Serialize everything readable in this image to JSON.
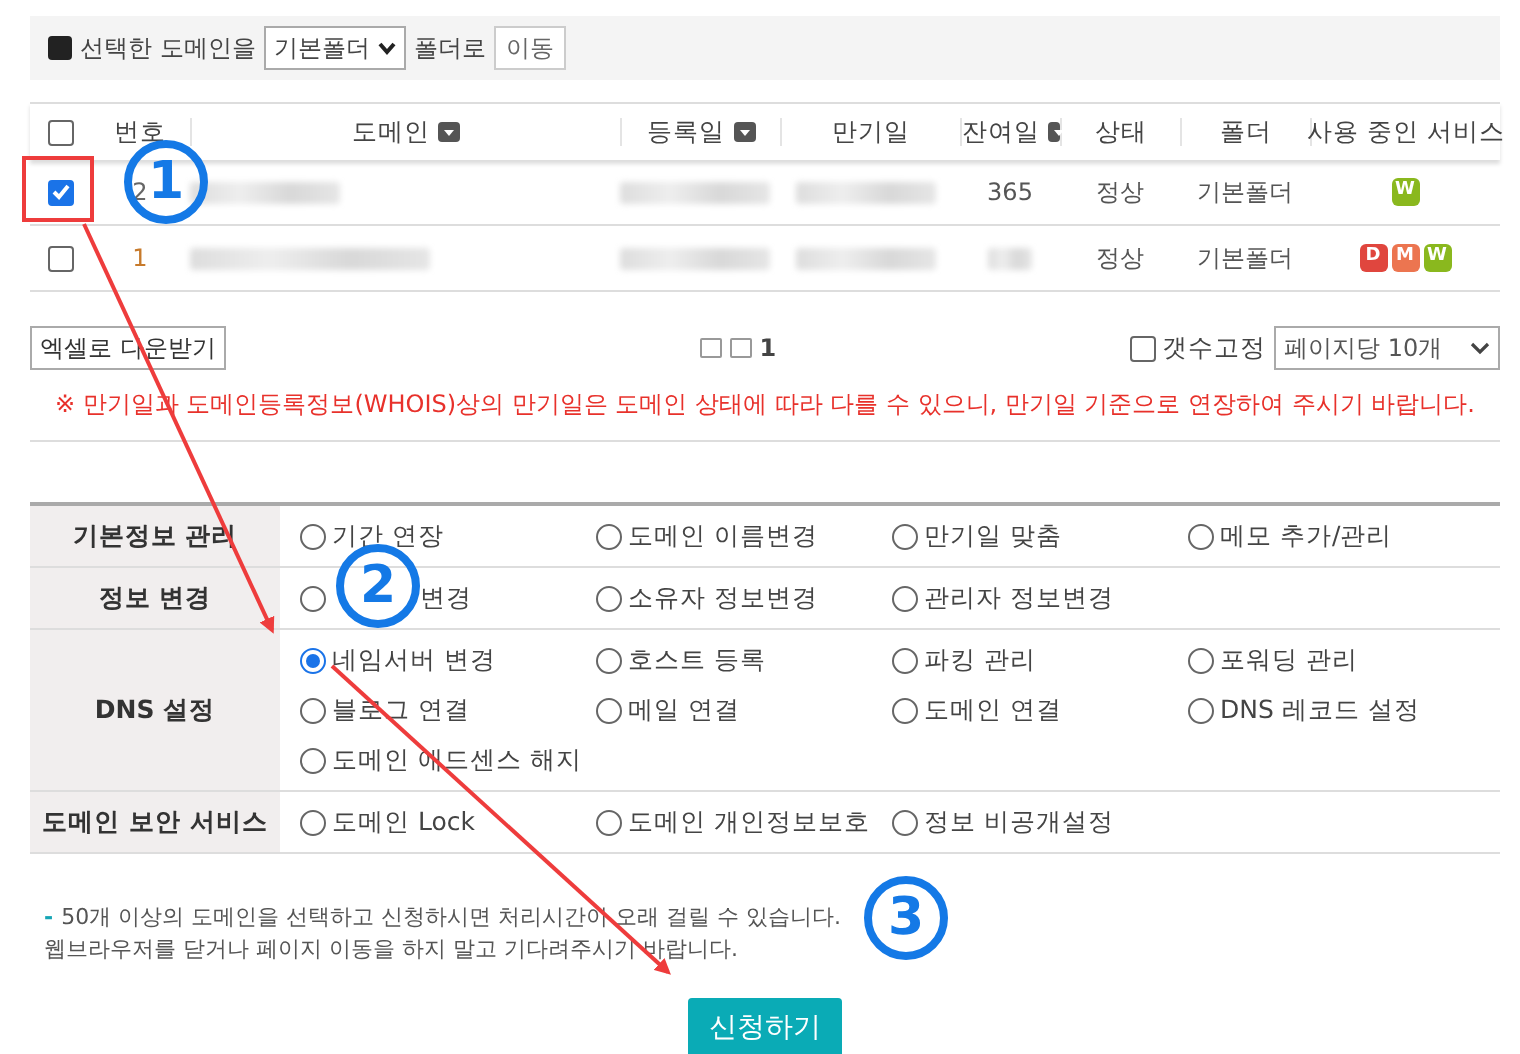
{
  "toolbar": {
    "label_before": "선택한 도메인을",
    "folder_select": "기본폴더",
    "label_after": "폴더로",
    "move_button": "이동"
  },
  "table": {
    "select_all": {
      "checked": false
    },
    "columns": [
      {
        "label": "번호",
        "sortable": false
      },
      {
        "label": "도메인",
        "sortable": true
      },
      {
        "label": "등록일",
        "sortable": true
      },
      {
        "label": "만기일",
        "sortable": false
      },
      {
        "label": "잔여일",
        "sortable": true
      },
      {
        "label": "상태",
        "sortable": false
      },
      {
        "label": "폴더",
        "sortable": false
      },
      {
        "label": "사용 중인 서비스",
        "sortable": false
      }
    ],
    "rows": [
      {
        "checked": true,
        "number": "2",
        "remaining": "365",
        "status": "정상",
        "folder": "기본폴더",
        "services": [
          {
            "letter": "W",
            "color": "#8ab81e"
          }
        ]
      },
      {
        "checked": false,
        "number": "1",
        "status": "정상",
        "folder": "기본폴더",
        "services": [
          {
            "letter": "D",
            "color": "#e0463e"
          },
          {
            "letter": "M",
            "color": "#ec7550"
          },
          {
            "letter": "W",
            "color": "#8ab81e"
          }
        ]
      }
    ]
  },
  "pagination": {
    "excel_button": "엑셀로 다운받기",
    "page": "1",
    "fixed_count": {
      "label": "갯수고정",
      "checked": false
    },
    "per_page": "페이지당 10개"
  },
  "notice": "※ 만기일과 도메인등록정보(WHOIS)상의 만기일은 도메인 상태에 따라 다를 수 있으니, 만기일 기준으로 연장하여 주시기 바랍니다.",
  "option_groups": [
    {
      "label": "기본정보 관리",
      "options": [
        {
          "label": "기간 연장",
          "selected": false
        },
        {
          "label": "도메인 이름변경",
          "selected": false
        },
        {
          "label": "만기일 맞춤",
          "selected": false
        },
        {
          "label": "메모 추가/관리",
          "selected": false
        }
      ]
    },
    {
      "label": "정보 변경",
      "options": [
        {
          "label": "변경",
          "selected": false,
          "covered": true
        },
        {
          "label": "소유자 정보변경",
          "selected": false
        },
        {
          "label": "관리자 정보변경",
          "selected": false
        }
      ]
    },
    {
      "label": "DNS 설정",
      "options": [
        {
          "label": "네임서버 변경",
          "selected": true
        },
        {
          "label": "호스트 등록",
          "selected": false
        },
        {
          "label": "파킹 관리",
          "selected": false
        },
        {
          "label": "포워딩 관리",
          "selected": false
        },
        {
          "label": "블로그 연결",
          "selected": false
        },
        {
          "label": "메일 연결",
          "selected": false
        },
        {
          "label": "도메인 연결",
          "selected": false
        },
        {
          "label": "DNS 레코드 설정",
          "selected": false
        },
        {
          "label": "도메인 애드센스 해지",
          "selected": false
        }
      ]
    },
    {
      "label": "도메인 보안 서비스",
      "options": [
        {
          "label": "도메인 Lock",
          "selected": false
        },
        {
          "label": "도메인 개인정보보호",
          "selected": false
        },
        {
          "label": "정보 비공개설정",
          "selected": false
        }
      ]
    }
  ],
  "footer_bullet": "-",
  "footer_notes": [
    "50개 이상의 도메인을 선택하고 신청하시면 처리시간이 오래 걸릴 수 있습니다.",
    "웹브라우저를 닫거나 페이지 이동을 하지 말고 기다려주시기 바랍니다."
  ],
  "submit_button": "신청하기",
  "step_markers": [
    "1",
    "2",
    "3"
  ]
}
